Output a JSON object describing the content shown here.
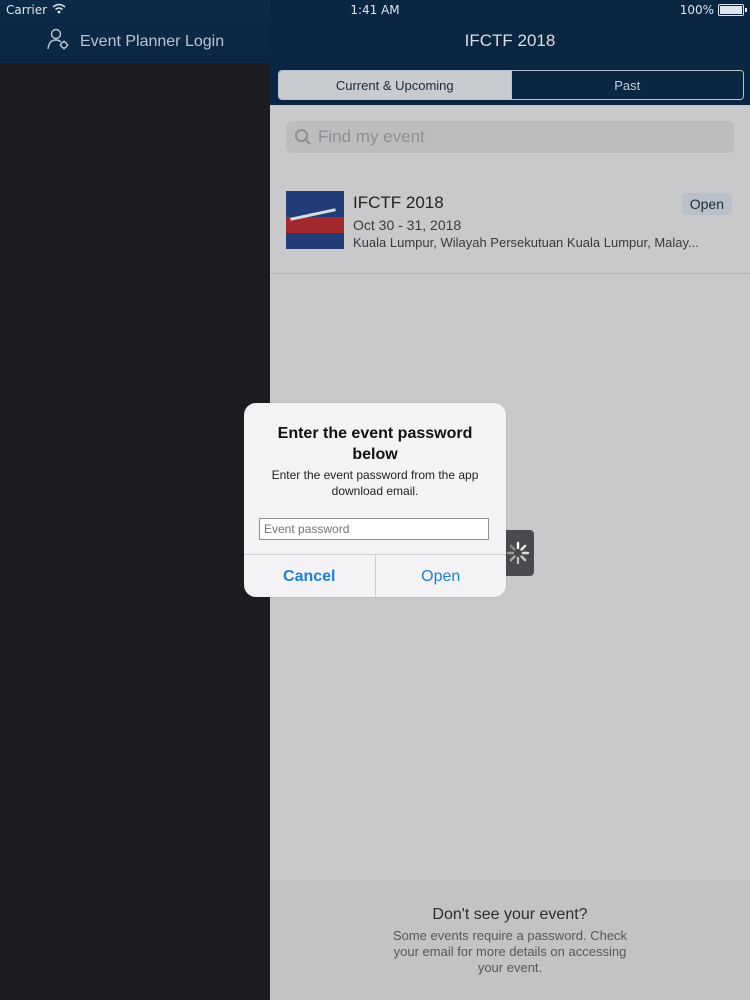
{
  "status_bar": {
    "carrier": "Carrier",
    "time": "1:41 AM",
    "battery": "100%"
  },
  "sidebar": {
    "login_label": "Event Planner Login",
    "login_icon": "person-gear-icon"
  },
  "header": {
    "title": "IFCTF 2018",
    "tabs": [
      {
        "label": "Current & Upcoming",
        "selected": true
      },
      {
        "label": "Past",
        "selected": false
      }
    ]
  },
  "search": {
    "placeholder": "Find my event"
  },
  "events": [
    {
      "name": "IFCTF 2018",
      "dates": "Oct 30 - 31, 2018",
      "location": "Kuala Lumpur, Wilayah Persekutuan Kuala Lumpur, Malay...",
      "badge": "Open"
    }
  ],
  "dialog": {
    "title": "Enter the event password below",
    "message": "Enter the event password from the app download email.",
    "input_placeholder": "Event password",
    "cancel_label": "Cancel",
    "open_label": "Open"
  },
  "footer": {
    "title": "Don't see your event?",
    "text": "Some events require a password. Check your email for more details on accessing your event."
  },
  "colors": {
    "nav_bar": "#0b2642",
    "sidebar": "#1c1c20",
    "dialog_button": "#1f7fd0"
  }
}
